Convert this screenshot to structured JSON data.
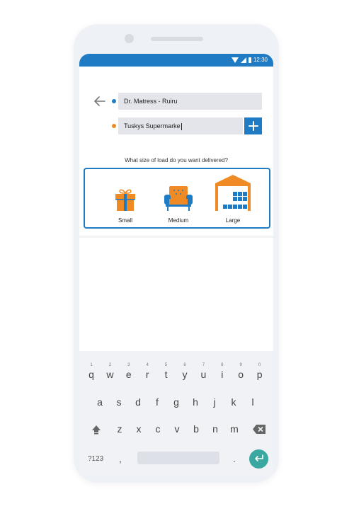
{
  "status": {
    "time": "12:30"
  },
  "route": {
    "origin": "Dr. Matress - Ruiru",
    "destination": "Tuskys Supermarke"
  },
  "question": "What size  of load do you want delivered?",
  "sizes": [
    {
      "label": "Small"
    },
    {
      "label": "Medium"
    },
    {
      "label": "Large"
    }
  ],
  "keyboard": {
    "row1": [
      {
        "key": "q",
        "num": "1"
      },
      {
        "key": "w",
        "num": "2"
      },
      {
        "key": "e",
        "num": "3"
      },
      {
        "key": "r",
        "num": "4"
      },
      {
        "key": "t",
        "num": "5"
      },
      {
        "key": "y",
        "num": "6"
      },
      {
        "key": "u",
        "num": "7"
      },
      {
        "key": "i",
        "num": "8"
      },
      {
        "key": "o",
        "num": "9"
      },
      {
        "key": "p",
        "num": "0"
      }
    ],
    "row2": [
      "a",
      "s",
      "d",
      "f",
      "g",
      "h",
      "j",
      "k",
      "l"
    ],
    "row3": [
      "z",
      "x",
      "c",
      "v",
      "b",
      "n",
      "m"
    ],
    "symbols_label": "?123",
    "comma": ",",
    "period": "."
  },
  "colors": {
    "primary": "#1f7cc4",
    "accent": "#f08a24",
    "enter": "#3aa8a0"
  }
}
